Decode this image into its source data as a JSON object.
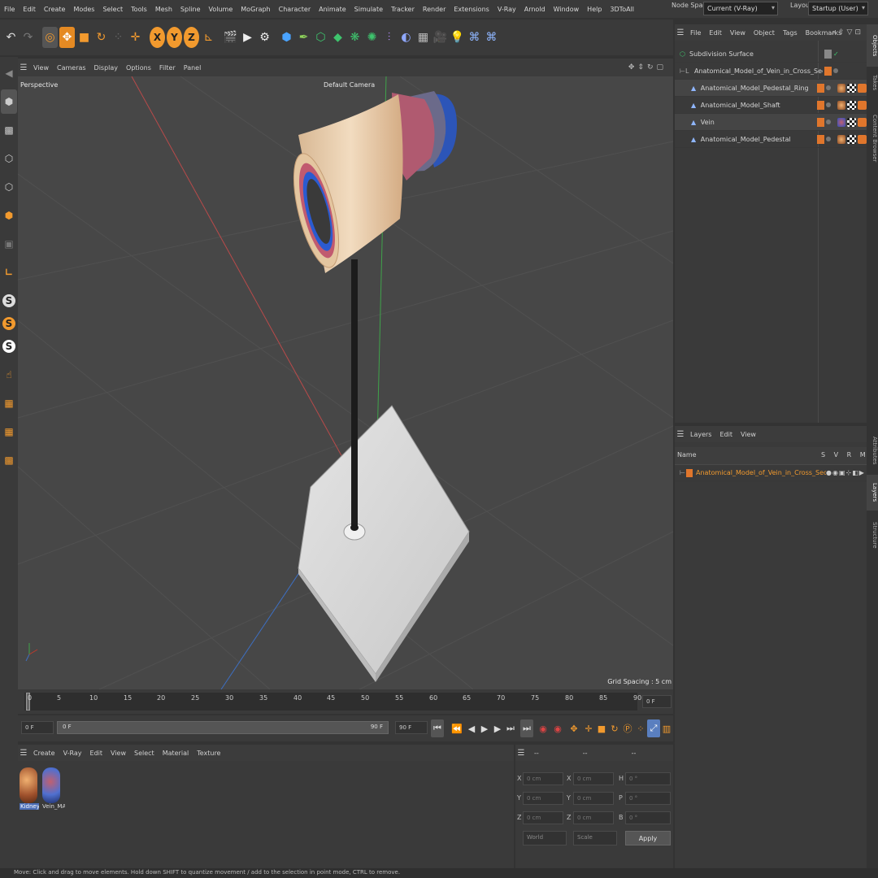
{
  "menubar": {
    "items": [
      "File",
      "Edit",
      "Create",
      "Modes",
      "Select",
      "Tools",
      "Mesh",
      "Spline",
      "Volume",
      "MoGraph",
      "Character",
      "Animate",
      "Simulate",
      "Tracker",
      "Render",
      "Extensions",
      "V-Ray",
      "Arnold",
      "Window",
      "Help",
      "3DToAll"
    ],
    "node_space_label": "Node Space:",
    "node_space_value": "Current (V-Ray)",
    "layout_label": "Layout:",
    "layout_value": "Startup (User)"
  },
  "viewport": {
    "menu": [
      "View",
      "Cameras",
      "Display",
      "Options",
      "Filter",
      "Panel"
    ],
    "projection": "Perspective",
    "camera": "Default Camera",
    "grid_spacing": "Grid Spacing : 5 cm"
  },
  "timeline": {
    "ticks": [
      "0",
      "5",
      "10",
      "15",
      "20",
      "25",
      "30",
      "35",
      "40",
      "45",
      "50",
      "55",
      "60",
      "65",
      "70",
      "75",
      "80",
      "85",
      "90"
    ],
    "current_frame": "0 F"
  },
  "transport": {
    "start_frame": "0 F",
    "range_start": "0 F",
    "range_end": "90 F",
    "end_frame": "90 F"
  },
  "materials": {
    "menu": [
      "Create",
      "V-Ray",
      "Edit",
      "View",
      "Select",
      "Material",
      "Texture"
    ],
    "items": [
      "Kidney_",
      "Vein_MA"
    ]
  },
  "coords": {
    "cols": [
      "--",
      "--",
      "--"
    ],
    "rows": [
      {
        "a": "X",
        "av": "0 cm",
        "b": "X",
        "bv": "0 cm",
        "c": "H",
        "cv": "0 °"
      },
      {
        "a": "Y",
        "av": "0 cm",
        "b": "Y",
        "bv": "0 cm",
        "c": "P",
        "cv": "0 °"
      },
      {
        "a": "Z",
        "av": "0 cm",
        "b": "Z",
        "bv": "0 cm",
        "c": "B",
        "cv": "0 °"
      }
    ],
    "space": "World",
    "mode": "Scale",
    "apply": "Apply"
  },
  "objects": {
    "menu": [
      "File",
      "Edit",
      "View",
      "Object",
      "Tags",
      "Bookmarks"
    ],
    "rows": [
      {
        "name": "Subdivision Surface"
      },
      {
        "name": "Anatomical_Model_of_Vein_in_Cross_Section_on_Shaft"
      },
      {
        "name": "Anatomical_Model_Pedestal_Ring"
      },
      {
        "name": "Anatomical_Model_Shaft"
      },
      {
        "name": "Vein"
      },
      {
        "name": "Anatomical_Model_Pedestal"
      }
    ]
  },
  "layers": {
    "menu": [
      "Layers",
      "Edit",
      "View"
    ],
    "header": {
      "name": "Name",
      "flags": "S V R M L A"
    },
    "rows": [
      {
        "name": "Anatomical_Model_of_Vein_in_Cross_Section_on_Shaft",
        "color": "#e0762c"
      }
    ]
  },
  "sidetabs": [
    "Objects",
    "Takes",
    "Content Browser",
    "Attributes",
    "Layers",
    "Structure"
  ],
  "status": {
    "text": "Move: Click and drag to move elements. Hold down SHIFT to quantize movement / add to the selection in point mode, CTRL to remove."
  },
  "colors": {
    "accent": "#f29a2e",
    "background": "#3a3a3a",
    "viewport": "#474747"
  }
}
